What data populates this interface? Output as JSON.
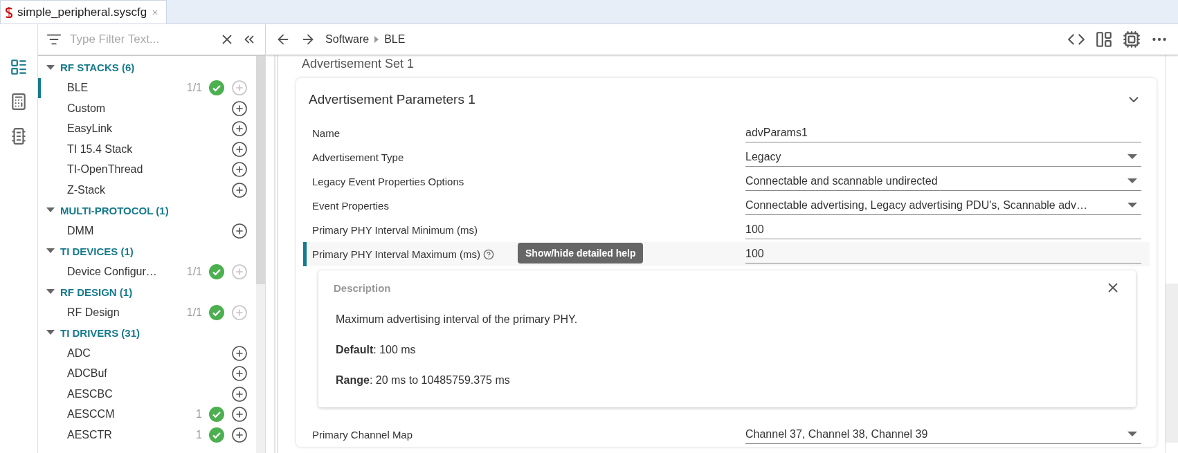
{
  "editor_tab": {
    "title": "simple_peripheral.syscfg"
  },
  "rail": [
    {
      "kind": "modules",
      "selected": true
    },
    {
      "kind": "calculator",
      "selected": false
    },
    {
      "kind": "chip",
      "selected": false
    }
  ],
  "sidebar": {
    "filter_placeholder": "Type Filter Text...",
    "groups": [
      {
        "title": "RF STACKS (6)",
        "expanded": true,
        "children": [
          {
            "name": "BLE",
            "count": "1/1",
            "ok": true,
            "add_enabled": false,
            "selected": true
          },
          {
            "name": "Custom",
            "ok": false,
            "add_enabled": true,
            "selected": false
          },
          {
            "name": "EasyLink",
            "ok": false,
            "add_enabled": true,
            "selected": false
          },
          {
            "name": "TI 15.4 Stack",
            "ok": false,
            "add_enabled": true,
            "selected": false
          },
          {
            "name": "TI-OpenThread",
            "ok": false,
            "add_enabled": true,
            "selected": false
          },
          {
            "name": "Z-Stack",
            "ok": false,
            "add_enabled": true,
            "selected": false
          }
        ]
      },
      {
        "title": "MULTI-PROTOCOL (1)",
        "expanded": true,
        "children": [
          {
            "name": "DMM",
            "ok": false,
            "add_enabled": true,
            "selected": false
          }
        ]
      },
      {
        "title": "TI DEVICES (1)",
        "expanded": true,
        "children": [
          {
            "name": "Device Configur…",
            "count": "1/1",
            "ok": true,
            "add_enabled": false,
            "selected": false
          }
        ]
      },
      {
        "title": "RF DESIGN (1)",
        "expanded": true,
        "children": [
          {
            "name": "RF Design",
            "count": "1/1",
            "ok": true,
            "add_enabled": false,
            "selected": false
          }
        ]
      },
      {
        "title": "TI DRIVERS (31)",
        "expanded": true,
        "children": [
          {
            "name": "ADC",
            "ok": false,
            "add_enabled": true,
            "selected": false
          },
          {
            "name": "ADCBuf",
            "ok": false,
            "add_enabled": true,
            "selected": false
          },
          {
            "name": "AESCBC",
            "ok": false,
            "add_enabled": true,
            "selected": false
          },
          {
            "name": "AESCCM",
            "count": "1",
            "ok": true,
            "add_enabled": true,
            "selected": false
          },
          {
            "name": "AESCTR",
            "count": "1",
            "ok": true,
            "add_enabled": true,
            "selected": false
          }
        ]
      }
    ]
  },
  "breadcrumb": [
    "Software",
    "BLE"
  ],
  "section_title": "Advertisement Set 1",
  "card": {
    "title": "Advertisement Parameters 1",
    "expanded": true,
    "rows": [
      {
        "label": "Name",
        "kind": "text",
        "value": "advParams1",
        "highlighted": false
      },
      {
        "label": "Advertisement Type",
        "kind": "select",
        "value": "Legacy",
        "highlighted": false
      },
      {
        "label": "Legacy Event Properties Options",
        "kind": "select",
        "value": "Connectable and scannable undirected",
        "highlighted": false
      },
      {
        "label": "Event Properties",
        "kind": "select",
        "value": "Connectable advertising, Legacy advertising PDU's, Scannable adv…",
        "highlighted": false
      },
      {
        "label": "Primary PHY Interval Minimum (ms)",
        "kind": "text",
        "value": "100",
        "highlighted": false
      },
      {
        "label": "Primary PHY Interval Maximum (ms)",
        "kind": "text",
        "value": "100",
        "highlighted": true,
        "tooltip": "Show/hide detailed help",
        "description": {
          "title": "Description",
          "lines": [
            "Maximum advertising interval of the primary PHY.",
            "**Default**: 100 ms",
            "**Range**: 20 ms to 10485759.375 ms"
          ]
        }
      },
      {
        "label": "Primary Channel Map",
        "kind": "select",
        "value": "Channel 37, Channel 38, Channel 39",
        "highlighted": false
      }
    ]
  }
}
